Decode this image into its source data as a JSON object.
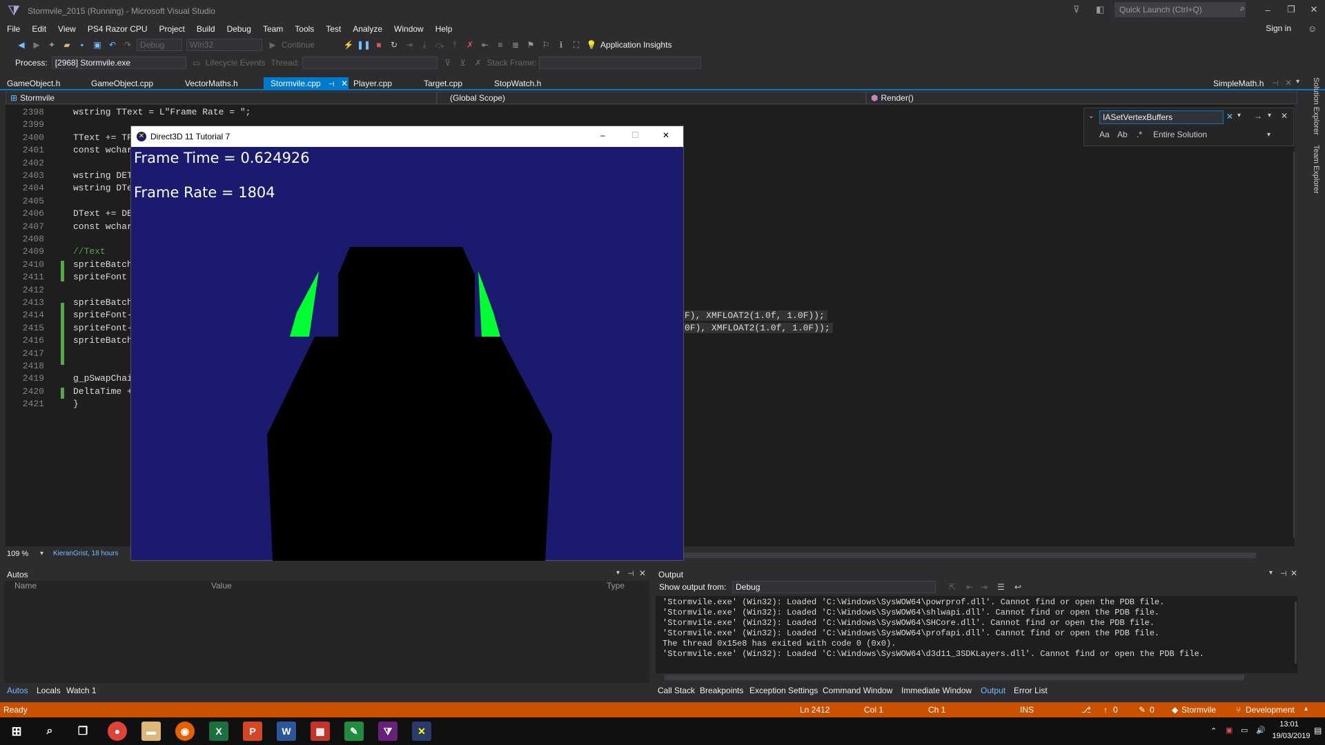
{
  "window": {
    "title": "Stormvile_2015 (Running) - Microsoft Visual Studio",
    "quick_launch_placeholder": "Quick Launch (Ctrl+Q)",
    "sign_in": "Sign in"
  },
  "menu": [
    "File",
    "Edit",
    "View",
    "PS4 Razor CPU",
    "Project",
    "Build",
    "Debug",
    "Team",
    "Tools",
    "Test",
    "Analyze",
    "Window",
    "Help"
  ],
  "toolbar": {
    "config": "Debug",
    "platform": "Win32",
    "continue_label": "Continue",
    "app_insights": "Application Insights",
    "process_label": "Process:",
    "process_value": "[2968] Stormvile.exe",
    "lifecycle": "Lifecycle Events",
    "thread_label": "Thread:",
    "stack_frame_label": "Stack Frame:"
  },
  "tabs": [
    "GameObject.h",
    "GameObject.cpp",
    "VectorMaths.h",
    "Stormvile.cpp",
    "Player.cpp",
    "Target.cpp",
    "StopWatch.h",
    "SimpleMath.h"
  ],
  "active_tab": "Stormvile.cpp",
  "navbar": {
    "project": "Stormvile",
    "scope": "(Global Scope)",
    "member": "Render()"
  },
  "find": {
    "query": "IASetVertexBuffers",
    "scope": "Entire Solution"
  },
  "side_tabs": [
    "Solution Explorer",
    "Team Explorer"
  ],
  "code_lines": [
    {
      "n": "2398",
      "t": "wstring TText = L\"Frame Rate = \";"
    },
    {
      "n": "2399",
      "t": ""
    },
    {
      "n": "2400",
      "t": "TText += TF"
    },
    {
      "n": "2401",
      "t": "const wchar"
    },
    {
      "n": "2402",
      "t": ""
    },
    {
      "n": "2403",
      "t": "wstring DET"
    },
    {
      "n": "2404",
      "t": "wstring DTe"
    },
    {
      "n": "2405",
      "t": ""
    },
    {
      "n": "2406",
      "t": "DText += DE"
    },
    {
      "n": "2407",
      "t": "const wchar"
    },
    {
      "n": "2408",
      "t": ""
    },
    {
      "n": "2409",
      "t": "//Text"
    },
    {
      "n": "2410",
      "t": "spriteBatch"
    },
    {
      "n": "2411",
      "t": "spriteFont "
    },
    {
      "n": "2412",
      "t": ""
    },
    {
      "n": "2413",
      "t": "spriteBatch"
    },
    {
      "n": "2414",
      "t": "spriteFont-"
    },
    {
      "n": "2415",
      "t": "spriteFont-"
    },
    {
      "n": "2416",
      "t": "spriteBatch"
    },
    {
      "n": "2417",
      "t": ""
    },
    {
      "n": "2418",
      "t": ""
    },
    {
      "n": "2419",
      "t": "g_pSwapChai"
    },
    {
      "n": "2420",
      "t": "DeltaTime +"
    },
    {
      "n": "2421",
      "t": "}"
    }
  ],
  "code_tail": {
    "l2414": "F), XMFLOAT2(1.0f, 1.0F));",
    "l2415": "0F), XMFLOAT2(1.0f, 1.0F));"
  },
  "zoom": "109 %",
  "author_hint": "KieranGrist, 18 hours",
  "d3d": {
    "title": "Direct3D 11 Tutorial 7",
    "frame_time": "Frame Time = 0.624926",
    "frame_rate": "Frame Rate = 1804"
  },
  "autos": {
    "title": "Autos",
    "col_name": "Name",
    "col_value": "Value",
    "col_type": "Type",
    "tabs": [
      "Autos",
      "Locals",
      "Watch 1"
    ]
  },
  "output": {
    "title": "Output",
    "show_from_label": "Show output from:",
    "show_from_value": "Debug",
    "lines": [
      "'Stormvile.exe' (Win32): Loaded 'C:\\Windows\\SysWOW64\\powrprof.dll'. Cannot find or open the PDB file.",
      "'Stormvile.exe' (Win32): Loaded 'C:\\Windows\\SysWOW64\\shlwapi.dll'. Cannot find or open the PDB file.",
      "'Stormvile.exe' (Win32): Loaded 'C:\\Windows\\SysWOW64\\SHCore.dll'. Cannot find or open the PDB file.",
      "'Stormvile.exe' (Win32): Loaded 'C:\\Windows\\SysWOW64\\profapi.dll'. Cannot find or open the PDB file.",
      "The thread 0x15e8 has exited with code 0 (0x0).",
      "'Stormvile.exe' (Win32): Loaded 'C:\\Windows\\SysWOW64\\d3d11_3SDKLayers.dll'. Cannot find or open the PDB file."
    ],
    "tabs": [
      "Call Stack",
      "Breakpoints",
      "Exception Settings",
      "Command Window",
      "Immediate Window",
      "Output",
      "Error List"
    ]
  },
  "status": {
    "ready": "Ready",
    "ln": "Ln 2412",
    "col": "Col 1",
    "ch": "Ch 1",
    "ins": "INS",
    "up": "0",
    "pencil": "0",
    "repo": "Stormvile",
    "branch": "Development"
  },
  "clock": {
    "time": "13:01",
    "date": "19/03/2019"
  },
  "colors": {
    "accent": "#007acc",
    "status_bar": "#ca5100",
    "d3d_bg": "#1a1a6e",
    "green_mesh": "#00ff33"
  }
}
